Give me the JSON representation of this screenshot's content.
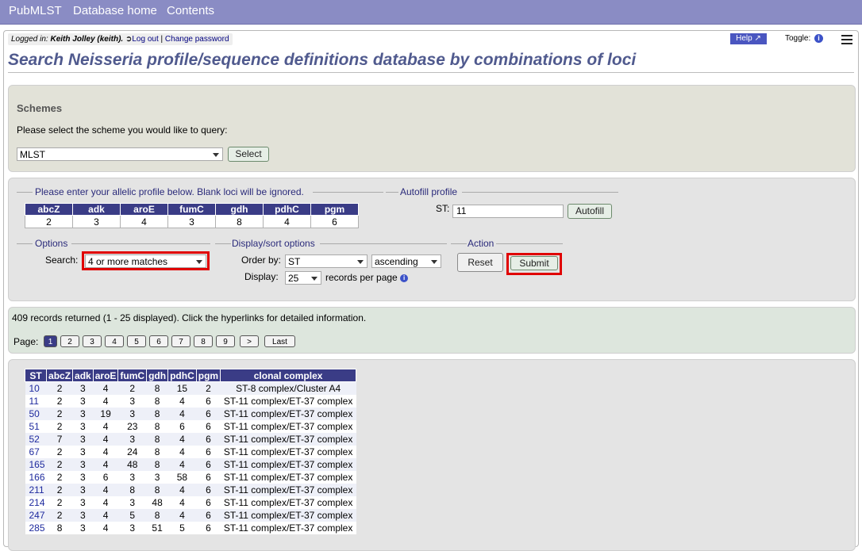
{
  "nav": {
    "brand": "PubMLST",
    "home": "Database home",
    "contents": "Contents"
  },
  "status": {
    "logged_in_label": "Logged in:",
    "user": "Keith Jolley (keith).",
    "logout": "Log out",
    "sep": "|",
    "change_password": "Change password"
  },
  "help": "Help",
  "toggle": "Toggle:",
  "page_title": "Search Neisseria profile/sequence definitions database by combinations of loci",
  "schemes": {
    "title": "Schemes",
    "prompt": "Please select the scheme you would like to query:",
    "selected": "MLST",
    "select_button": "Select"
  },
  "profile": {
    "legend": "Please enter your allelic profile below. Blank loci will be ignored.",
    "loci": [
      "abcZ",
      "adk",
      "aroE",
      "fumC",
      "gdh",
      "pdhC",
      "pgm"
    ],
    "values": [
      "2",
      "3",
      "4",
      "3",
      "8",
      "4",
      "6"
    ]
  },
  "autofill": {
    "legend": "Autofill profile",
    "st_label": "ST:",
    "st_value": "11",
    "button": "Autofill"
  },
  "options": {
    "legend": "Options",
    "search_label": "Search:",
    "search_value": "4 or more matches"
  },
  "display_sort": {
    "legend": "Display/sort options",
    "order_label": "Order by:",
    "order_value": "ST",
    "direction_value": "ascending",
    "display_label": "Display:",
    "display_value": "25",
    "per_page": "records per page"
  },
  "action": {
    "legend": "Action",
    "reset": "Reset",
    "submit": "Submit"
  },
  "results": {
    "summary": "409 records returned (1 - 25 displayed). Click the hyperlinks for detailed information.",
    "page_label": "Page:",
    "pages": [
      "1",
      "2",
      "3",
      "4",
      "5",
      "6",
      "7",
      "8",
      "9",
      ">",
      "Last"
    ]
  },
  "table": {
    "headers": [
      "ST",
      "abcZ",
      "adk",
      "aroE",
      "fumC",
      "gdh",
      "pdhC",
      "pgm",
      "clonal complex"
    ],
    "rows": [
      [
        "10",
        "2",
        "3",
        "4",
        "2",
        "8",
        "15",
        "2",
        "ST-8 complex/Cluster A4"
      ],
      [
        "11",
        "2",
        "3",
        "4",
        "3",
        "8",
        "4",
        "6",
        "ST-11 complex/ET-37 complex"
      ],
      [
        "50",
        "2",
        "3",
        "19",
        "3",
        "8",
        "4",
        "6",
        "ST-11 complex/ET-37 complex"
      ],
      [
        "51",
        "2",
        "3",
        "4",
        "23",
        "8",
        "6",
        "6",
        "ST-11 complex/ET-37 complex"
      ],
      [
        "52",
        "7",
        "3",
        "4",
        "3",
        "8",
        "4",
        "6",
        "ST-11 complex/ET-37 complex"
      ],
      [
        "67",
        "2",
        "3",
        "4",
        "24",
        "8",
        "4",
        "6",
        "ST-11 complex/ET-37 complex"
      ],
      [
        "165",
        "2",
        "3",
        "4",
        "48",
        "8",
        "4",
        "6",
        "ST-11 complex/ET-37 complex"
      ],
      [
        "166",
        "2",
        "3",
        "6",
        "3",
        "3",
        "58",
        "6",
        "ST-11 complex/ET-37 complex"
      ],
      [
        "211",
        "2",
        "3",
        "4",
        "8",
        "8",
        "4",
        "6",
        "ST-11 complex/ET-37 complex"
      ],
      [
        "214",
        "2",
        "3",
        "4",
        "3",
        "48",
        "4",
        "6",
        "ST-11 complex/ET-37 complex"
      ],
      [
        "247",
        "2",
        "3",
        "4",
        "5",
        "8",
        "4",
        "6",
        "ST-11 complex/ET-37 complex"
      ],
      [
        "285",
        "8",
        "3",
        "4",
        "3",
        "51",
        "5",
        "6",
        "ST-11 complex/ET-37 complex"
      ]
    ]
  }
}
